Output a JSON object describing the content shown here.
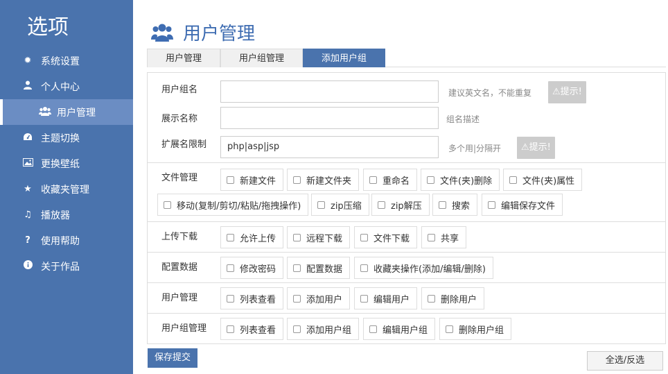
{
  "sidebar": {
    "title": "选项",
    "items": [
      {
        "label": "系统设置",
        "icon": "gear-icon"
      },
      {
        "label": "个人中心",
        "icon": "user-icon"
      },
      {
        "label": "用户管理",
        "icon": "users-icon"
      },
      {
        "label": "主题切换",
        "icon": "dashboard-icon"
      },
      {
        "label": "更换壁纸",
        "icon": "image-icon"
      },
      {
        "label": "收藏夹管理",
        "icon": "star-icon"
      },
      {
        "label": "播放器",
        "icon": "music-icon"
      },
      {
        "label": "使用帮助",
        "icon": "question-icon"
      },
      {
        "label": "关于作品",
        "icon": "info-icon"
      }
    ]
  },
  "page": {
    "title": "用户管理",
    "icon": "users-icon"
  },
  "tabs": [
    {
      "label": "用户管理"
    },
    {
      "label": "用户组管理"
    },
    {
      "label": "添加用户组",
      "active": true
    }
  ],
  "form": {
    "group_name": {
      "label": "用户组名",
      "value": "",
      "hint": "建议英文名，不能重复",
      "tip": "提示!"
    },
    "display_name": {
      "label": "展示名称",
      "value": "",
      "hint": "组名描述"
    },
    "ext_limit": {
      "label": "扩展名限制",
      "value": "php|asp|jsp",
      "hint": "多个用|分隔开",
      "tip": "提示!"
    }
  },
  "permissions": {
    "file": {
      "label": "文件管理",
      "options": [
        "新建文件",
        "新建文件夹",
        "重命名",
        "文件(夹)删除",
        "文件(夹)属性",
        "移动(复制/剪切/粘贴/拖拽操作)",
        "zip压缩",
        "zip解压",
        "搜索",
        "编辑保存文件"
      ]
    },
    "upload": {
      "label": "上传下载",
      "options": [
        "允许上传",
        "远程下载",
        "文件下载",
        "共享"
      ]
    },
    "config": {
      "label": "配置数据",
      "options": [
        "修改密码",
        "配置数据",
        "收藏夹操作(添加/编辑/删除)"
      ]
    },
    "user": {
      "label": "用户管理",
      "options": [
        "列表查看",
        "添加用户",
        "编辑用户",
        "删除用户"
      ]
    },
    "group": {
      "label": "用户组管理",
      "options": [
        "列表查看",
        "添加用户组",
        "编辑用户组",
        "删除用户组"
      ]
    }
  },
  "actions": {
    "save": "保存提交",
    "select_all": "全选/反选"
  },
  "colors": {
    "primary": "#4a73ad",
    "active_item": "#6b8dc3"
  }
}
